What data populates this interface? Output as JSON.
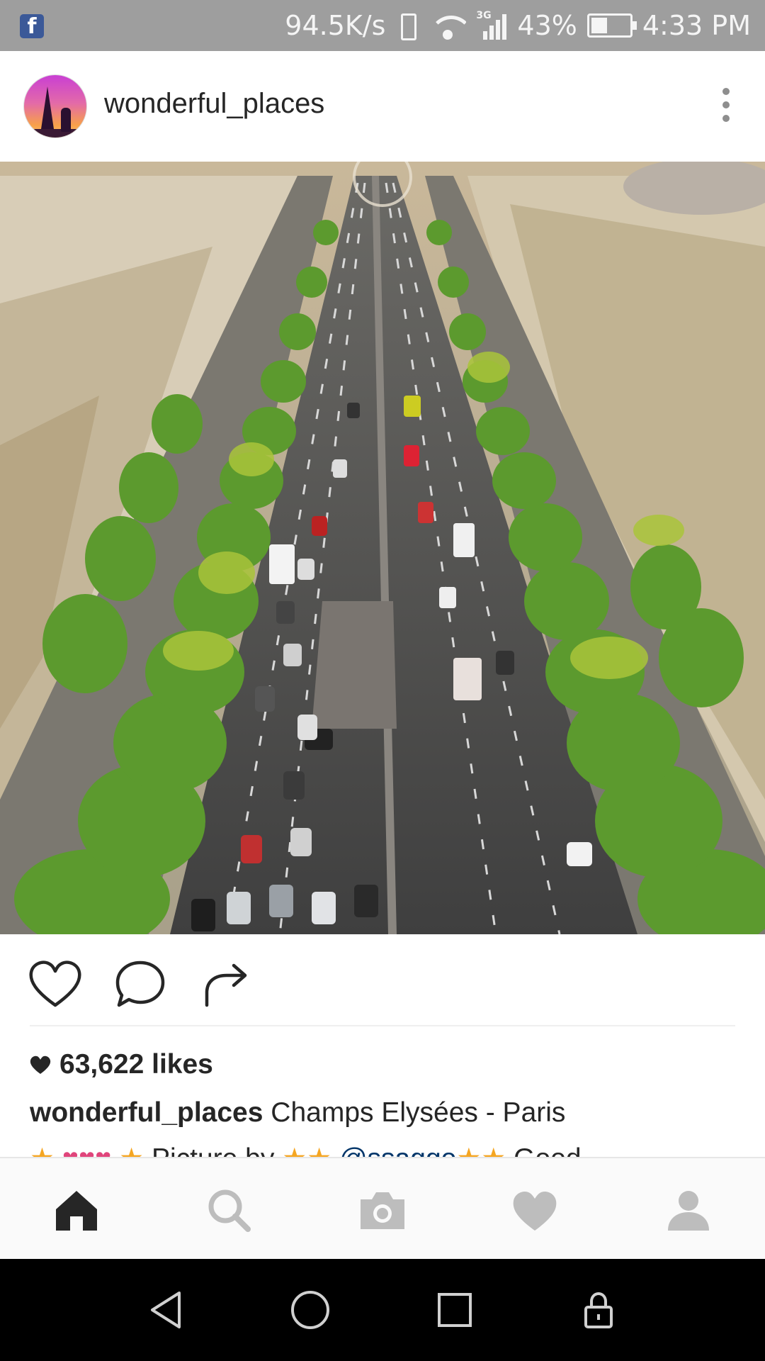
{
  "status_bar": {
    "network_speed": "94.5K/s",
    "network_type": "3G",
    "battery": "43%",
    "time": "4:33 PM",
    "icons": [
      "facebook-notification-icon",
      "vibrate-icon",
      "wifi-icon",
      "signal-icon",
      "battery-icon"
    ]
  },
  "post": {
    "username": "wonderful_places",
    "image_subject": "Champs Elysées - Paris",
    "likes": "63,622 likes",
    "caption_username": "wonderful_places",
    "caption_text": "Champs Elysées - Paris",
    "caption_line2": {
      "picture_by": "Picture by",
      "mention": "@ssaggo",
      "trailing": "Good"
    }
  },
  "actions": {
    "icons": [
      "heart-icon",
      "comment-icon",
      "share-icon"
    ]
  },
  "bottom_nav": {
    "items": [
      "home",
      "search",
      "camera",
      "activity",
      "profile"
    ],
    "active": "home"
  },
  "android_nav": {
    "items": [
      "back",
      "home",
      "recents",
      "lock"
    ]
  },
  "colors": {
    "status_bar": "#9e9e9e",
    "facebook": "#3b5998",
    "text": "#262626",
    "icon_gray": "#bdbdbd",
    "mention": "#003569"
  }
}
